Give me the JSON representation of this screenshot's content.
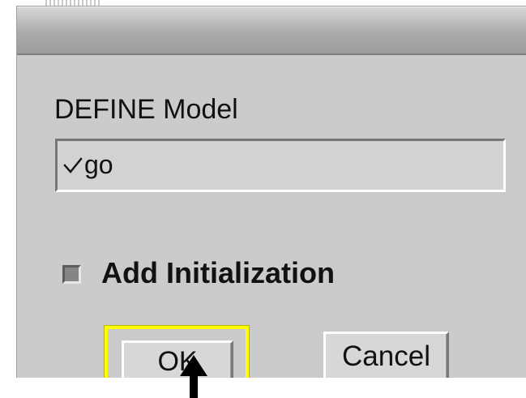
{
  "dialog": {
    "heading": "DEFINE Model",
    "model_field": {
      "value": "go",
      "check_icon": "check-icon"
    },
    "option": {
      "label": "Add Initialization",
      "checked": false
    },
    "buttons": {
      "ok": "OK",
      "cancel": "Cancel"
    }
  }
}
